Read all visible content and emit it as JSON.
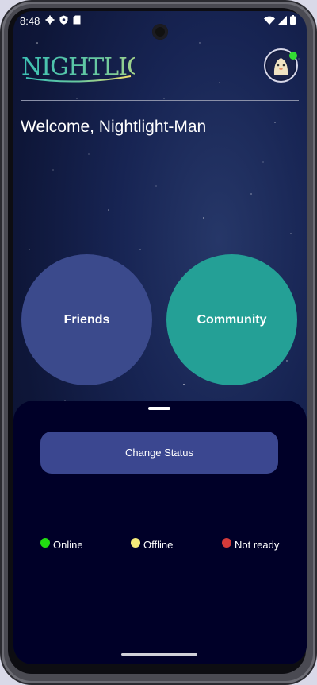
{
  "status_bar": {
    "time": "8:48",
    "icons_left": [
      "gear-icon",
      "shield-icon",
      "sim-card-icon"
    ],
    "icons_right": [
      "wifi-icon",
      "signal-icon",
      "battery-icon"
    ]
  },
  "header": {
    "logo_text": "NightLight",
    "avatar_status_color": "#33dd33"
  },
  "welcome": "Welcome, Nightlight-Man",
  "main": {
    "friends_label": "Friends",
    "community_label": "Community",
    "friends_color": "#3b4a8c",
    "community_color": "#24a096"
  },
  "sheet": {
    "change_status_label": "Change Status",
    "legend": [
      {
        "label": "Online",
        "color": "#22dd11"
      },
      {
        "label": "Offline",
        "color": "#f4ea7a"
      },
      {
        "label": "Not ready",
        "color": "#d33a3a"
      }
    ]
  }
}
